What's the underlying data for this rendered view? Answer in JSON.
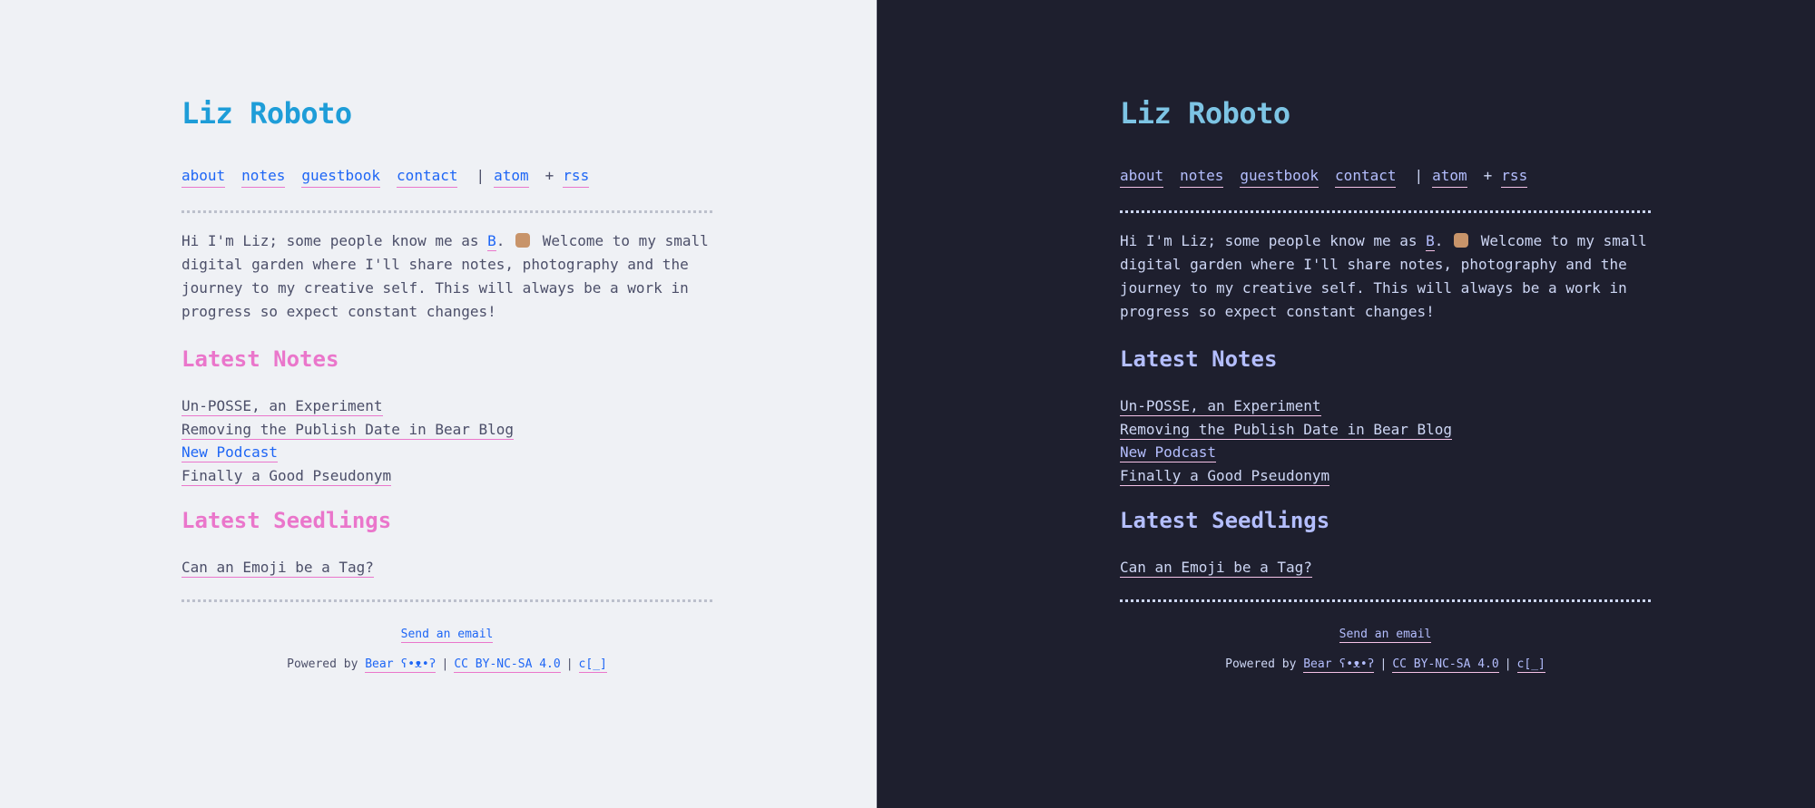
{
  "site": {
    "title": "Liz Roboto",
    "nav": {
      "about": "about",
      "notes": "notes",
      "guestbook": "guestbook",
      "contact": "contact",
      "sep": "|",
      "atom": "atom",
      "plus": "+",
      "rss": "rss"
    },
    "intro": {
      "part1": "Hi I'm Liz; some people know me as ",
      "link": "B",
      "part2": ".",
      "wave_icon": "waving-hand-icon",
      "part3": "Welcome to my small digital garden where I'll share notes, photography and the journey to my creative self. This will always be a work in progress so expect constant changes!"
    },
    "latest_notes": {
      "heading": "Latest Notes",
      "items": [
        "Un-POSSE, an Experiment",
        "Removing the Publish Date in Bear Blog",
        "New Podcast",
        "Finally a Good Pseudonym"
      ]
    },
    "latest_seedlings": {
      "heading": "Latest Seedlings",
      "items": [
        "Can an Emoji be a Tag?"
      ]
    },
    "footer": {
      "email": "Send an email",
      "powered_by": "Powered by ",
      "bear": "Bear ʕ•ᴥ•ʔ",
      "sep": "|",
      "license": "CC BY-NC-SA 4.0",
      "c": "c[_]"
    }
  },
  "colors": {
    "light_bg": "#eff1f5",
    "dark_bg": "#1e1f2e",
    "light_title": "#1e9dd8",
    "dark_title": "#7dc4e4",
    "light_heading": "#ea76cb",
    "dark_heading": "#b4befe"
  }
}
